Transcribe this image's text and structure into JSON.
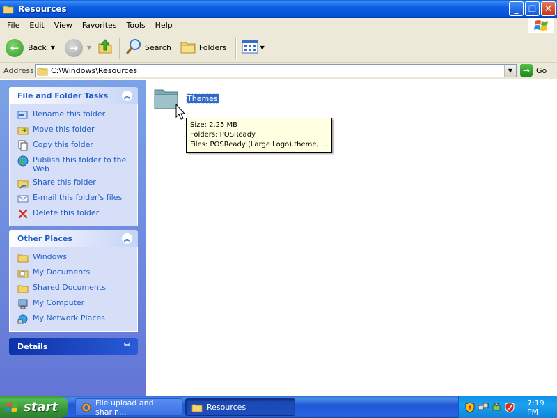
{
  "window": {
    "title": "Resources",
    "controls": {
      "minimize": "_",
      "maximize": "❐",
      "close": "✕"
    }
  },
  "menu": [
    "File",
    "Edit",
    "View",
    "Favorites",
    "Tools",
    "Help"
  ],
  "toolbar": {
    "back_label": "Back",
    "search_label": "Search",
    "folders_label": "Folders"
  },
  "address": {
    "label": "Address",
    "path": "C:\\Windows\\Resources",
    "go_label": "Go"
  },
  "tasks_panel": {
    "title": "File and Folder Tasks",
    "items": [
      {
        "label": "Rename this folder",
        "icon": "rename-icon"
      },
      {
        "label": "Move this folder",
        "icon": "move-icon"
      },
      {
        "label": "Copy this folder",
        "icon": "copy-icon"
      },
      {
        "label": "Publish this folder to the Web",
        "icon": "publish-web-icon"
      },
      {
        "label": "Share this folder",
        "icon": "share-icon"
      },
      {
        "label": "E-mail this folder's files",
        "icon": "email-icon"
      },
      {
        "label": "Delete this folder",
        "icon": "delete-icon"
      }
    ]
  },
  "places_panel": {
    "title": "Other Places",
    "items": [
      {
        "label": "Windows",
        "icon": "folder-icon"
      },
      {
        "label": "My Documents",
        "icon": "my-documents-icon"
      },
      {
        "label": "Shared Documents",
        "icon": "shared-folder-icon"
      },
      {
        "label": "My Computer",
        "icon": "my-computer-icon"
      },
      {
        "label": "My Network Places",
        "icon": "network-places-icon"
      }
    ]
  },
  "details_panel": {
    "title": "Details"
  },
  "content": {
    "folder_name": "Themes",
    "tooltip": {
      "size": "Size: 2.25 MB",
      "folders": "Folders: POSReady",
      "files": "Files: POSReady (Large Logo).theme, ..."
    }
  },
  "taskbar": {
    "start_label": "start",
    "buttons": [
      {
        "label": "File upload and sharin...",
        "active": false
      },
      {
        "label": "Resources",
        "active": true
      }
    ],
    "clock": "7:19 PM"
  }
}
